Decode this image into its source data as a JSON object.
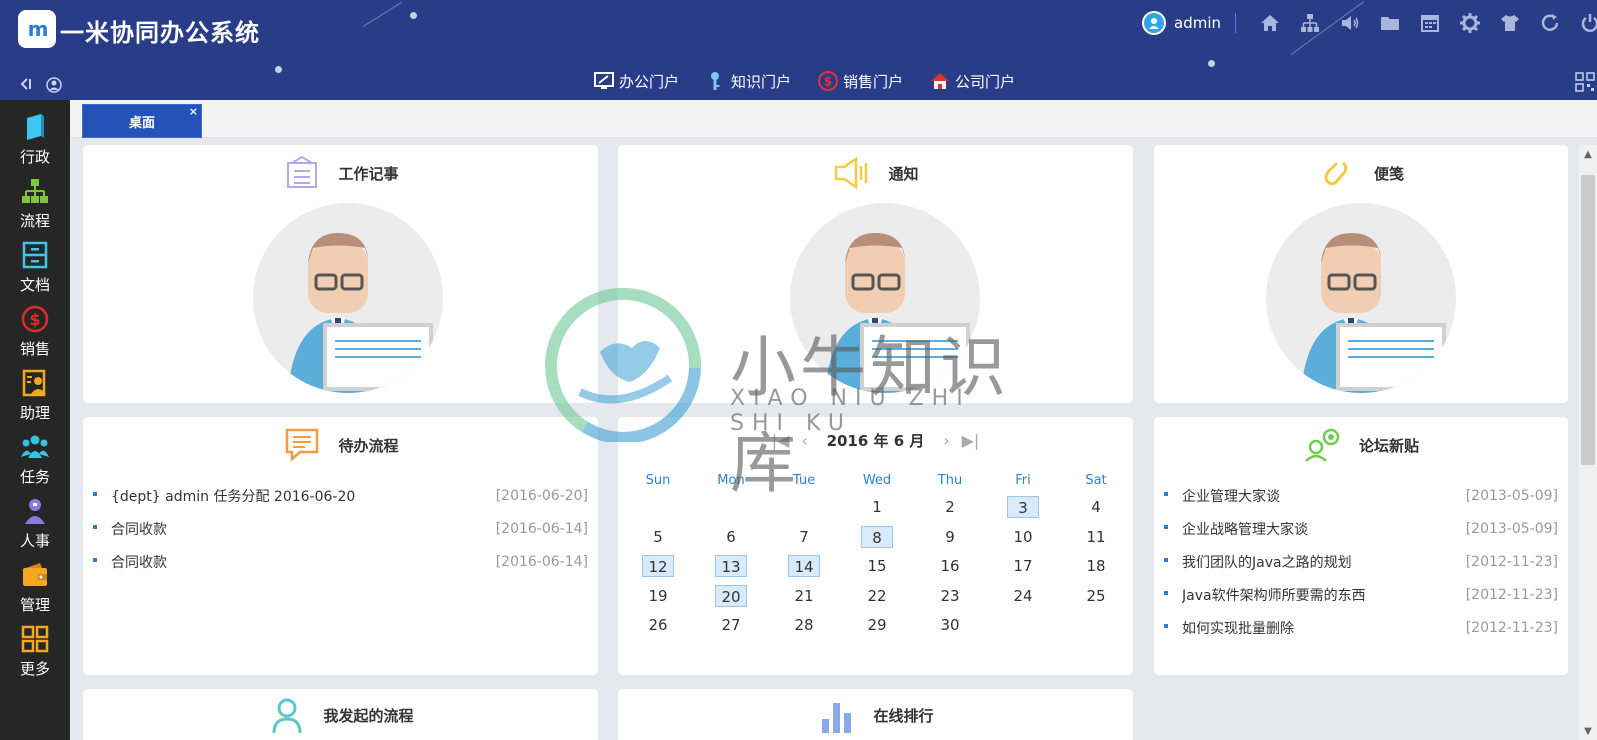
{
  "app": {
    "title": "一米协同办公系统",
    "logo_text": "m"
  },
  "user": {
    "name": "admin"
  },
  "top_icons": [
    "home-icon",
    "org-chart-icon",
    "volume-icon",
    "folder-icon",
    "calendar-icon",
    "gear-icon",
    "shirt-icon",
    "refresh-icon",
    "power-icon"
  ],
  "portals": [
    {
      "label": "办公门户",
      "icon": "monitor-icon"
    },
    {
      "label": "知识门户",
      "icon": "key-icon"
    },
    {
      "label": "销售门户",
      "icon": "dollar-icon"
    },
    {
      "label": "公司门户",
      "icon": "house-icon"
    }
  ],
  "sidebar": {
    "items": [
      {
        "label": "行政",
        "icon": "book-icon",
        "color": "#3ec5f0"
      },
      {
        "label": "流程",
        "icon": "org-chart-icon",
        "color": "#7ec53b"
      },
      {
        "label": "文档",
        "icon": "cabinet-icon",
        "color": "#3ec5f0"
      },
      {
        "label": "销售",
        "icon": "dollar-icon",
        "color": "#e02b2b"
      },
      {
        "label": "助理",
        "icon": "assistant-icon",
        "color": "#f3a81f"
      },
      {
        "label": "任务",
        "icon": "team-icon",
        "color": "#35c4e0"
      },
      {
        "label": "人事",
        "icon": "person-icon",
        "color": "#8a7ae0"
      },
      {
        "label": "管理",
        "icon": "wallet-icon",
        "color": "#f3a81f"
      },
      {
        "label": "更多",
        "icon": "grid-icon",
        "color": "#f3a81f"
      }
    ]
  },
  "tabs": [
    {
      "label": "桌面",
      "close": "×"
    }
  ],
  "panels": {
    "work_notes": {
      "title": "工作记事"
    },
    "notice": {
      "title": "通知"
    },
    "memo": {
      "title": "便笺"
    },
    "pending": {
      "title": "待办流程",
      "items": [
        {
          "text": "{dept} admin 任务分配 2016-06-20",
          "date": "[2016-06-20]"
        },
        {
          "text": "合同收款",
          "date": "[2016-06-14]"
        },
        {
          "text": "合同收款",
          "date": "[2016-06-14]"
        }
      ]
    },
    "forum": {
      "title": "论坛新贴",
      "items": [
        {
          "text": "企业管理大家谈",
          "date": "[2013-05-09]"
        },
        {
          "text": "企业战略管理大家谈",
          "date": "[2013-05-09]"
        },
        {
          "text": "我们团队的Java之路的规划",
          "date": "[2012-11-23]"
        },
        {
          "text": "Java软件架构师所要需的东西",
          "date": "[2012-11-23]"
        },
        {
          "text": "如何实现批量删除",
          "date": "[2012-11-23]"
        }
      ]
    },
    "my_flow": {
      "title": "我发起的流程"
    },
    "ranking": {
      "title": "在线排行"
    }
  },
  "calendar": {
    "month_label": "2016 年 6 月",
    "nav": {
      "first": "|◀",
      "prev": "‹",
      "next": "›",
      "last": "▶|"
    },
    "weekdays": [
      "Sun",
      "Mon",
      "Tue",
      "Wed",
      "Thu",
      "Fri",
      "Sat"
    ],
    "first_weekday": 3,
    "days_in_month": 30,
    "marked_days": [
      3,
      8,
      12,
      13,
      14,
      20
    ]
  },
  "watermark": {
    "text": "小牛知识库",
    "sub": "XIAO NIU ZHI SHI KU"
  },
  "scrollbar": {
    "up": "▲",
    "down": "▼"
  }
}
